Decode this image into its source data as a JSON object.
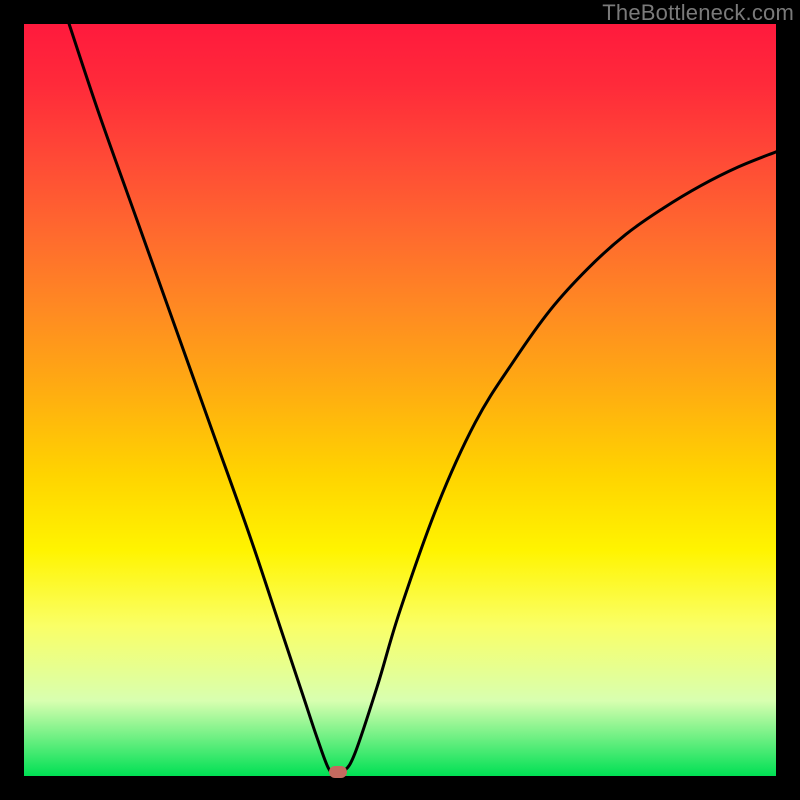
{
  "watermark": "TheBottleneck.com",
  "chart_data": {
    "type": "line",
    "title": "",
    "xlabel": "",
    "ylabel": "",
    "xlim": [
      0,
      100
    ],
    "ylim": [
      0,
      100
    ],
    "series": [
      {
        "name": "curve",
        "x": [
          6,
          10,
          15,
          20,
          25,
          30,
          34,
          37,
          39,
          40.5,
          41.5,
          42.5,
          44,
          47,
          50,
          55,
          60,
          65,
          70,
          75,
          80,
          85,
          90,
          95,
          100
        ],
        "y": [
          100,
          88,
          74,
          60,
          46,
          32,
          20,
          11,
          5,
          1,
          0.3,
          0.6,
          3,
          12,
          22,
          36,
          47,
          55,
          62,
          67.5,
          72,
          75.5,
          78.5,
          81,
          83
        ]
      }
    ],
    "marker": {
      "x": 41.8,
      "y": 0.5
    },
    "gradient_stops": [
      {
        "pos": 0,
        "color": "#ff1a3d"
      },
      {
        "pos": 0.5,
        "color": "#ffd400"
      },
      {
        "pos": 0.95,
        "color": "#d8ffb0"
      },
      {
        "pos": 1,
        "color": "#00e054"
      }
    ]
  }
}
